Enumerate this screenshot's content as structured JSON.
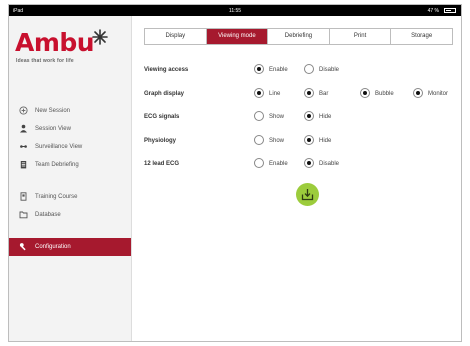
{
  "statusbar": {
    "left": "iPad",
    "time": "11:55",
    "right": "47 %"
  },
  "brand": {
    "name": "Ambu",
    "tagline": "Ideas that work for life",
    "color": "#c8102e"
  },
  "sidebar": {
    "items": [
      {
        "label": "New Session",
        "icon": "plus-circle-icon"
      },
      {
        "label": "Session View",
        "icon": "person-icon"
      },
      {
        "label": "Surveillance View",
        "icon": "surveillance-icon"
      },
      {
        "label": "Team Debriefing",
        "icon": "clipboard-icon"
      },
      {
        "label": "Training Course",
        "icon": "course-icon"
      },
      {
        "label": "Database",
        "icon": "folder-icon"
      },
      {
        "label": "Configuration",
        "icon": "wrench-icon",
        "active": true
      }
    ]
  },
  "tabs": [
    {
      "label": "Display"
    },
    {
      "label": "Viewing mode",
      "active": true
    },
    {
      "label": "Debriefing"
    },
    {
      "label": "Print"
    },
    {
      "label": "Storage"
    }
  ],
  "settings": [
    {
      "label": "Viewing access",
      "options": [
        {
          "label": "Enable",
          "selected": true
        },
        {
          "label": "Disable",
          "selected": false
        }
      ]
    },
    {
      "label": "Graph display",
      "options": [
        {
          "label": "Line",
          "selected": true
        },
        {
          "label": "Bar",
          "selected": true
        },
        {
          "label": "Bubble",
          "selected": true
        },
        {
          "label": "Monitor",
          "selected": true
        }
      ]
    },
    {
      "label": "ECG signals",
      "options": [
        {
          "label": "Show",
          "selected": false
        },
        {
          "label": "Hide",
          "selected": true
        }
      ]
    },
    {
      "label": "Physiology",
      "options": [
        {
          "label": "Show",
          "selected": false
        },
        {
          "label": "Hide",
          "selected": true
        }
      ]
    },
    {
      "label": "12 lead ECG",
      "options": [
        {
          "label": "Enable",
          "selected": false
        },
        {
          "label": "Disable",
          "selected": true
        }
      ]
    }
  ],
  "save_button": {
    "icon": "save-download-icon",
    "color": "#9ccc3c"
  },
  "colors": {
    "accent": "#a6192e"
  },
  "battery_level": 0.47
}
